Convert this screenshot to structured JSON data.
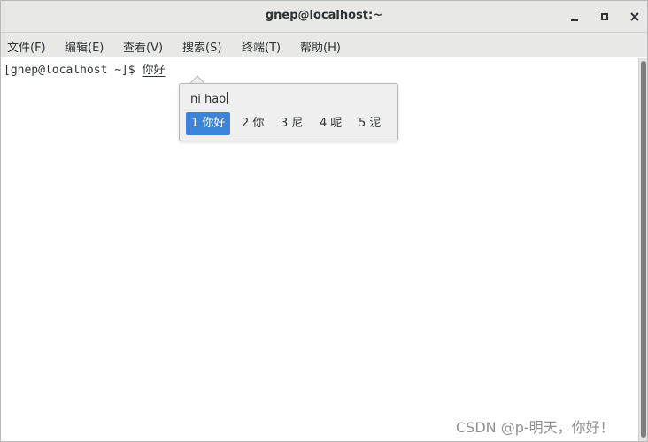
{
  "window": {
    "title": "gnep@localhost:~"
  },
  "menu": {
    "file": "文件(F)",
    "edit": "编辑(E)",
    "view": "查看(V)",
    "search": "搜索(S)",
    "terminal": "终端(T)",
    "help": "帮助(H)"
  },
  "terminal": {
    "prompt": "[gnep@localhost ~]$ ",
    "preedit": "你好"
  },
  "ime": {
    "pinyin": "ni hao",
    "candidates": [
      "1 你好",
      "2 你",
      "3 尼",
      "4 呢",
      "5 泥"
    ],
    "selected_index": 0,
    "highlight_color": "#3c84d8"
  },
  "watermark": "CSDN @p-明天，你好！"
}
